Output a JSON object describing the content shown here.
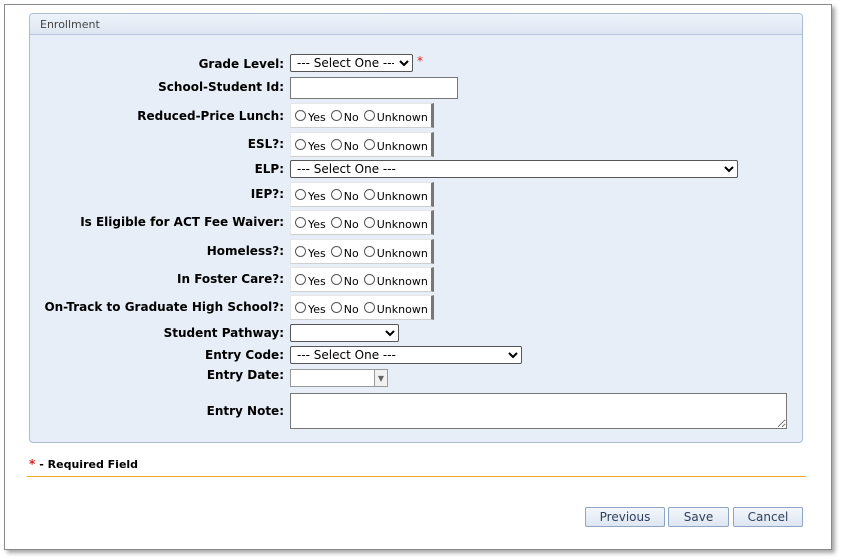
{
  "panel": {
    "title": "Enrollment"
  },
  "radio_options": [
    "Yes",
    "No",
    "Unknown"
  ],
  "fields": {
    "grade_level": {
      "label": "Grade Level:",
      "value": "--- Select One ---",
      "required_mark": "*"
    },
    "school_student_id": {
      "label": "School-Student Id:",
      "value": ""
    },
    "reduced_price_lunch": {
      "label": "Reduced-Price Lunch:"
    },
    "esl": {
      "label": "ESL?:"
    },
    "elp": {
      "label": "ELP:",
      "value": "--- Select One ---"
    },
    "iep": {
      "label": "IEP?:"
    },
    "act_fee_waiver": {
      "label": "Is Eligible for ACT Fee Waiver:"
    },
    "homeless": {
      "label": "Homeless?:"
    },
    "foster_care": {
      "label": "In Foster Care?:"
    },
    "on_track": {
      "label": "On-Track to Graduate High School?:"
    },
    "student_pathway": {
      "label": "Student Pathway:",
      "value": ""
    },
    "entry_code": {
      "label": "Entry Code:",
      "value": "--- Select One ---"
    },
    "entry_date": {
      "label": "Entry Date:",
      "value": ""
    },
    "entry_note": {
      "label": "Entry Note:",
      "value": ""
    }
  },
  "footer": {
    "required_star": "*",
    "required_text": "- Required Field",
    "buttons": {
      "previous": "Previous",
      "save": "Save",
      "cancel": "Cancel"
    }
  },
  "colors": {
    "required": "#e0201a",
    "divider": "#f0a92c",
    "panel_bg": "#e8eef7"
  }
}
